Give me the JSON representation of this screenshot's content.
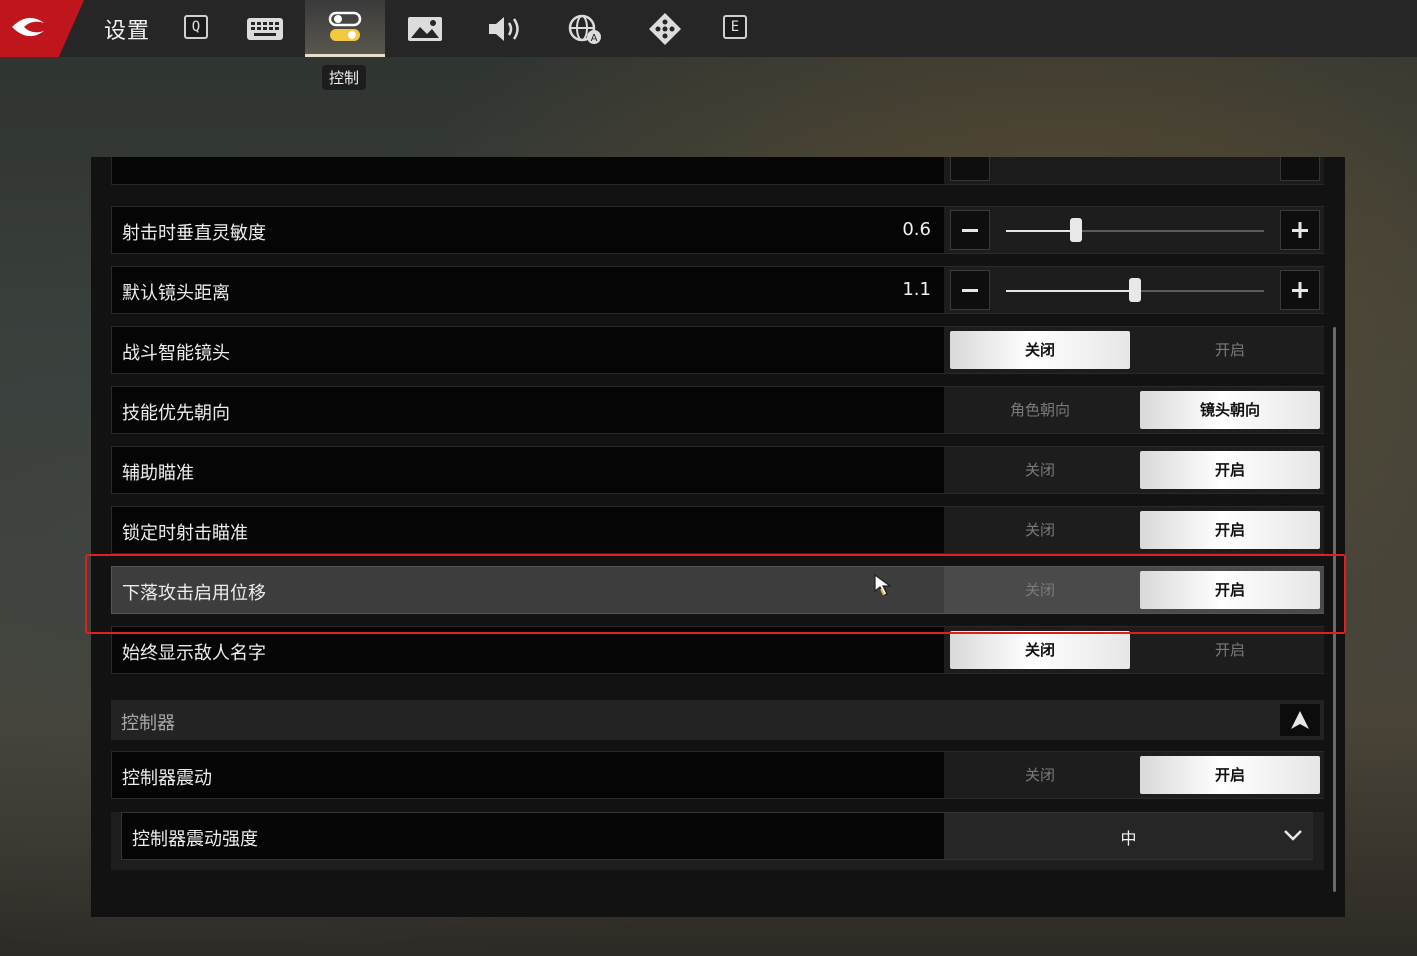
{
  "header": {
    "title": "设置",
    "tabs": [
      {
        "key": "q_key",
        "label": "Q"
      },
      {
        "key": "keyboard",
        "icon": "keyboard-icon"
      },
      {
        "key": "control",
        "icon": "toggle-icon",
        "active": true,
        "tooltip": "控制"
      },
      {
        "key": "graphics",
        "icon": "image-icon"
      },
      {
        "key": "audio",
        "icon": "speaker-icon"
      },
      {
        "key": "language",
        "icon": "globe-icon"
      },
      {
        "key": "network",
        "icon": "network-icon"
      },
      {
        "key": "e_key",
        "label": "E"
      }
    ],
    "tooltip": "控制"
  },
  "settings": {
    "rows": [
      {
        "label": "射击时垂直灵敏度",
        "type": "slider",
        "value": "0.6",
        "fraction": 0.27
      },
      {
        "label": "默认镜头距离",
        "type": "slider",
        "value": "1.1",
        "fraction": 0.5
      },
      {
        "label": "战斗智能镜头",
        "type": "toggle",
        "left": "关闭",
        "right": "开启",
        "selected": "left"
      },
      {
        "label": "技能优先朝向",
        "type": "toggle",
        "left": "角色朝向",
        "right": "镜头朝向",
        "selected": "right"
      },
      {
        "label": "辅助瞄准",
        "type": "toggle",
        "left": "关闭",
        "right": "开启",
        "selected": "right"
      },
      {
        "label": "锁定时射击瞄准",
        "type": "toggle",
        "left": "关闭",
        "right": "开启",
        "selected": "right"
      },
      {
        "label": "下落攻击启用位移",
        "type": "toggle",
        "left": "关闭",
        "right": "开启",
        "selected": "right",
        "highlighted": true
      },
      {
        "label": "始终显示敌人名字",
        "type": "toggle",
        "left": "关闭",
        "right": "开启",
        "selected": "left"
      }
    ],
    "section": {
      "label": "控制器"
    },
    "controller_rows": [
      {
        "label": "控制器震动",
        "type": "toggle",
        "left": "关闭",
        "right": "开启",
        "selected": "right"
      }
    ],
    "dropdown": {
      "label": "控制器震动强度",
      "value": "中"
    }
  },
  "colors": {
    "accent_red": "#c0151c",
    "highlight_box": "#e02020",
    "selected_option": "#ffffff"
  }
}
